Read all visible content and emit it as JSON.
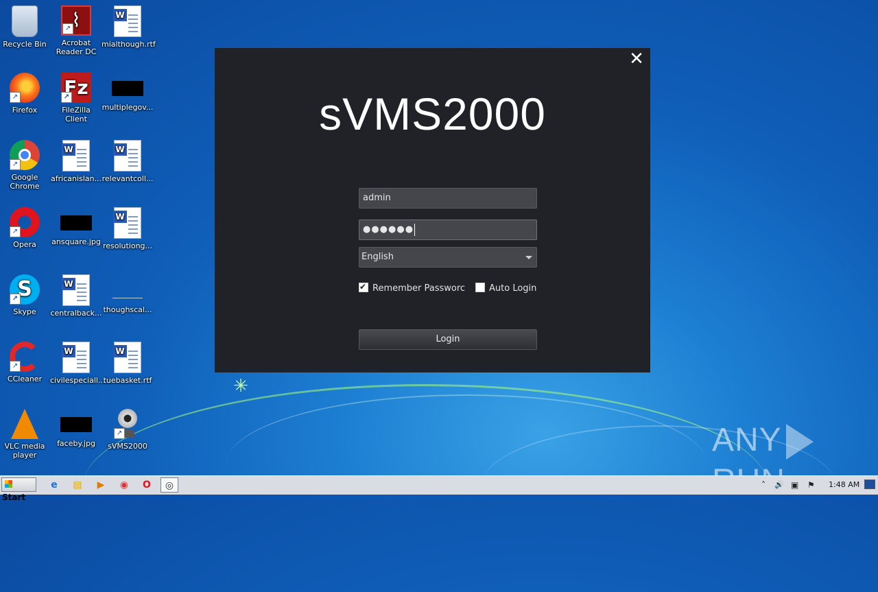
{
  "desktop": {
    "icons": [
      {
        "label": "Recycle Bin",
        "icon": "recycle-bin-icon"
      },
      {
        "label": "Acrobat Reader DC",
        "icon": "acrobat-icon"
      },
      {
        "label": "mialthough.rtf",
        "icon": "word-document-icon"
      },
      {
        "label": "Firefox",
        "icon": "firefox-icon"
      },
      {
        "label": "FileZilla Client",
        "icon": "filezilla-icon"
      },
      {
        "label": "multiplegov...",
        "icon": "image-file-icon"
      },
      {
        "label": "Google Chrome",
        "icon": "chrome-icon"
      },
      {
        "label": "africanislan...",
        "icon": "word-document-icon"
      },
      {
        "label": "relevantcoll...",
        "icon": "word-document-icon"
      },
      {
        "label": "Opera",
        "icon": "opera-icon"
      },
      {
        "label": "ansquare.jpg",
        "icon": "image-file-icon"
      },
      {
        "label": "resolutiong...",
        "icon": "word-document-icon"
      },
      {
        "label": "Skype",
        "icon": "skype-icon"
      },
      {
        "label": "centralback...",
        "icon": "word-document-icon"
      },
      {
        "label": "thoughscal...",
        "icon": "blank-file-icon"
      },
      {
        "label": "CCleaner",
        "icon": "ccleaner-icon"
      },
      {
        "label": "civilespeciall...",
        "icon": "word-document-icon"
      },
      {
        "label": "tuebasket.rtf",
        "icon": "word-document-icon"
      },
      {
        "label": "VLC media player",
        "icon": "vlc-icon"
      },
      {
        "label": "faceby.jpg",
        "icon": "image-file-icon"
      },
      {
        "label": "sVMS2000",
        "icon": "webcam-icon"
      }
    ]
  },
  "dialog": {
    "close_glyph": "✕",
    "app_title": "sVMS2000",
    "username_value": "admin",
    "password_mask": "●●●●●●",
    "language_selected": "English",
    "remember_label": "Remember Passworc",
    "remember_checked": true,
    "auto_login_label": "Auto Login",
    "auto_login_checked": false,
    "login_button": "Login",
    "background_color": "#212227"
  },
  "watermark": {
    "left": "ANY",
    "right": "RUN"
  },
  "taskbar": {
    "start_label": "Start",
    "pinned": [
      {
        "icon": "internet-explorer-icon",
        "glyph": "e"
      },
      {
        "icon": "file-explorer-icon",
        "glyph": "▤"
      },
      {
        "icon": "media-player-icon",
        "glyph": "▶"
      },
      {
        "icon": "chrome-icon",
        "glyph": "◉"
      },
      {
        "icon": "opera-icon",
        "glyph": "O"
      },
      {
        "icon": "svms2000-icon",
        "glyph": "◎"
      }
    ],
    "tray": {
      "chevron": "˄",
      "volume": "🔊",
      "network": "▣",
      "flag": "⚑",
      "clock": "1:48 AM"
    }
  }
}
